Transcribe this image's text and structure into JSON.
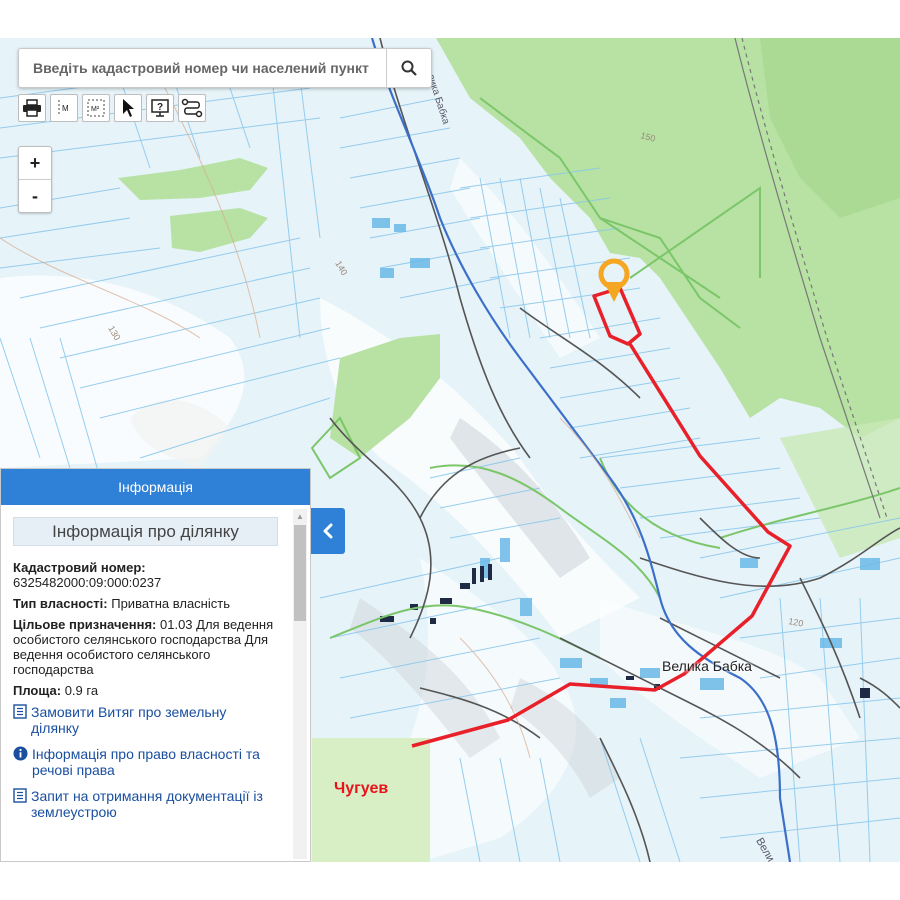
{
  "search": {
    "placeholder": "Введіть кадастровий номер чи населений пункт",
    "button_icon": "search-icon"
  },
  "toolbar": {
    "tools": [
      "print-icon",
      "measure-distance-icon",
      "measure-area-icon",
      "pointer-icon",
      "info-identify-icon",
      "route-icon"
    ],
    "measure_line_label": "M",
    "measure_area_label": "M²"
  },
  "zoom": {
    "in_label": "+",
    "out_label": "-"
  },
  "panel": {
    "header": "Інформація",
    "section_title": "Інформація про ділянку",
    "cadastral_label": "Кадастровий номер:",
    "cadastral_value": "6325482000:09:000:0237",
    "ownership_label": "Тип власності:",
    "ownership_value": "Приватна власність",
    "purpose_label": "Цільове призначення:",
    "purpose_value": "01.03 Для ведення особистого селянського господарства Для ведення особистого селянського господарства",
    "area_label": "Площа:",
    "area_value": "0.9 га",
    "links": [
      {
        "icon": "document-icon",
        "label": "Замовити Витяг про земельну ділянку"
      },
      {
        "icon": "info-icon",
        "label": "Інформація про право власності та речові права"
      },
      {
        "icon": "document-icon",
        "label": "Запит на отримання документації із землеустрою"
      }
    ]
  },
  "map": {
    "village_label": "Велика Бабка",
    "city_label": "Чугуев",
    "river_label_top": "Велика Бабка",
    "road_label_right": "Вели",
    "contour_labels": [
      "150",
      "140",
      "130",
      "120"
    ],
    "colors": {
      "route": "#e8202a",
      "marker": "#f5a623",
      "forest": "#b9e3a6",
      "parcel_line": "#8cc8ec",
      "water": "#3b6fc9"
    }
  }
}
